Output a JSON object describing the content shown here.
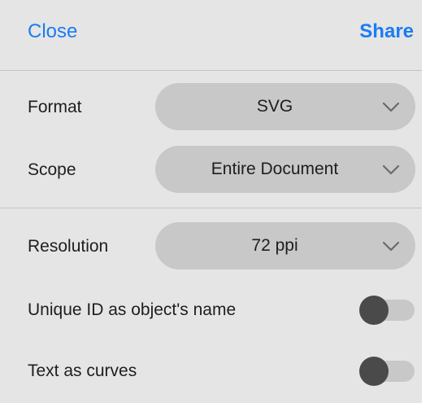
{
  "header": {
    "close_label": "Close",
    "share_label": "Share"
  },
  "format": {
    "label": "Format",
    "value": "SVG"
  },
  "scope": {
    "label": "Scope",
    "value": "Entire Document"
  },
  "resolution": {
    "label": "Resolution",
    "value": "72 ppi"
  },
  "unique_id": {
    "label": "Unique ID as object's name",
    "enabled": false
  },
  "text_curves": {
    "label": "Text as curves",
    "enabled": false
  },
  "colors": {
    "accent": "#1a7cf2",
    "panel_bg": "#e5e5e5",
    "control_bg": "#c8c8c8",
    "knob": "#4a4a4a"
  }
}
